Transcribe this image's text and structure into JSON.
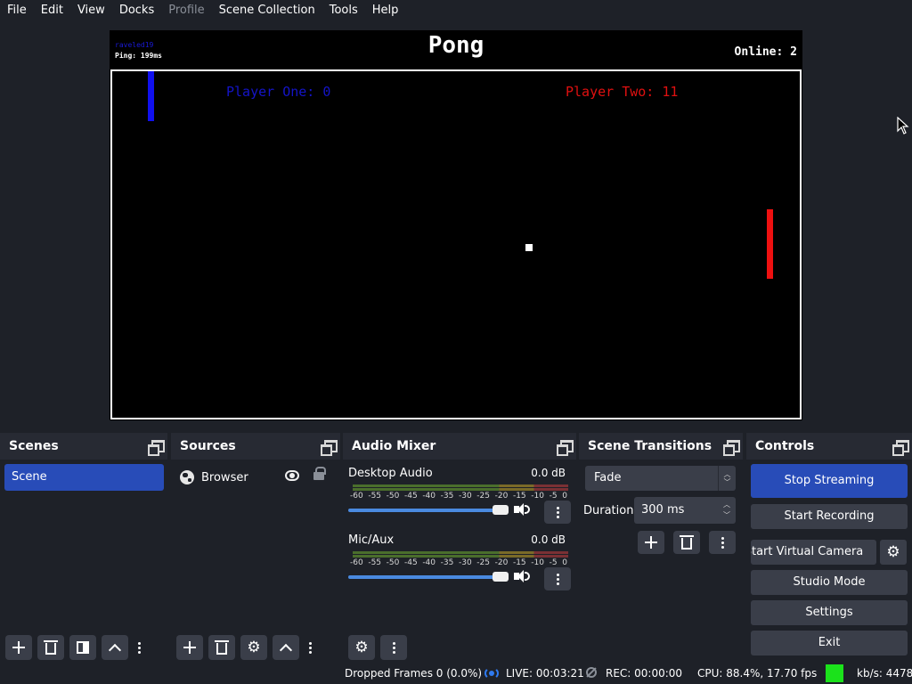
{
  "menu": {
    "items": [
      {
        "label": "File",
        "enabled": true
      },
      {
        "label": "Edit",
        "enabled": true
      },
      {
        "label": "View",
        "enabled": true
      },
      {
        "label": "Docks",
        "enabled": true
      },
      {
        "label": "Profile",
        "enabled": false
      },
      {
        "label": "Scene Collection",
        "enabled": true
      },
      {
        "label": "Tools",
        "enabled": true
      },
      {
        "label": "Help",
        "enabled": true
      }
    ]
  },
  "preview": {
    "game_title": "Pong",
    "player_name": "raveled19",
    "ping": "Ping: 199ms",
    "online": "Online: 2",
    "score_one": "Player One: 0",
    "score_two": "Player Two: 11",
    "colors": {
      "player_one": "#1010ee",
      "player_two": "#ee1010",
      "background": "#000000"
    }
  },
  "scenes": {
    "title": "Scenes",
    "items": [
      {
        "label": "Scene",
        "selected": true
      }
    ]
  },
  "sources": {
    "title": "Sources",
    "items": [
      {
        "label": "Browser",
        "icon": "globe-icon",
        "visible": true,
        "locked": false
      }
    ]
  },
  "mixer": {
    "title": "Audio Mixer",
    "channels": [
      {
        "name": "Desktop Audio",
        "db": "0.0 dB"
      },
      {
        "name": "Mic/Aux",
        "db": "0.0 dB"
      }
    ],
    "ticks": [
      "-60",
      "-55",
      "-50",
      "-45",
      "-40",
      "-35",
      "-30",
      "-25",
      "-20",
      "-15",
      "-10",
      "-5",
      "0"
    ]
  },
  "transitions": {
    "title": "Scene Transitions",
    "selected": "Fade",
    "duration_label": "Duration",
    "duration_value": "300 ms"
  },
  "controls": {
    "title": "Controls",
    "stop_streaming": "Stop Streaming",
    "start_recording": "Start Recording",
    "start_virtual_camera": "Start Virtual Camera",
    "studio_mode": "Studio Mode",
    "settings": "Settings",
    "exit": "Exit"
  },
  "status": {
    "dropped_frames": "Dropped Frames 0 (0.0%)",
    "live": "LIVE: 00:03:21",
    "rec": "REC: 00:00:00",
    "cpu": "CPU: 88.4%, 17.70 fps",
    "kbps": "kb/s: 4478",
    "health_color": "#1be21b"
  },
  "theme": {
    "accent": "#284cb8",
    "panel": "#272a33",
    "background": "#1e2128",
    "button": "#3a3e49"
  }
}
